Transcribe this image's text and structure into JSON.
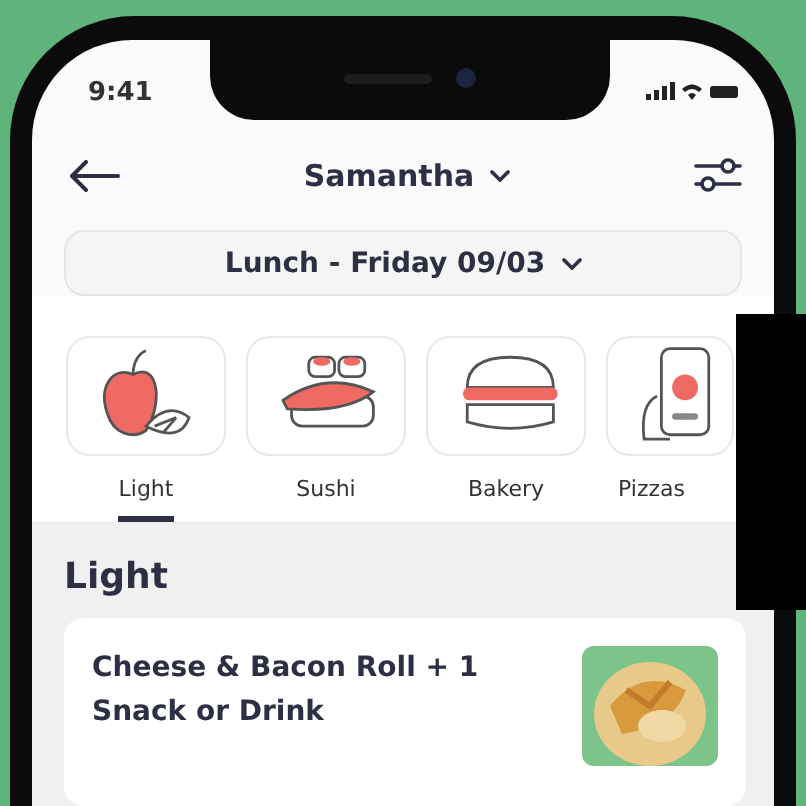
{
  "status_bar": {
    "time": "9:41"
  },
  "header": {
    "title": "Samantha"
  },
  "meal_selector": {
    "label": "Lunch - Friday 09/03"
  },
  "categories": [
    {
      "label": "Light",
      "selected": true
    },
    {
      "label": "Sushi",
      "selected": false
    },
    {
      "label": "Bakery",
      "selected": false
    },
    {
      "label": "Pizzas",
      "selected": false
    }
  ],
  "section": {
    "title": "Light",
    "items": [
      {
        "name": "Cheese & Bacon Roll + 1 Snack or Drink"
      }
    ]
  }
}
